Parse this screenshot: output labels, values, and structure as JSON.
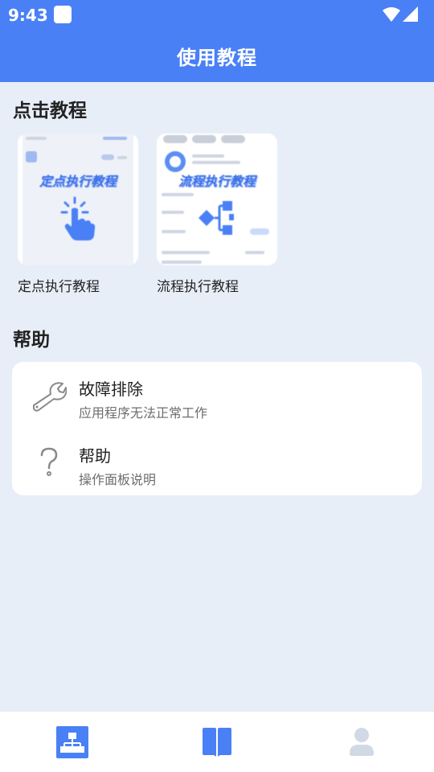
{
  "status_bar": {
    "time": "9:43",
    "icons": [
      "notification-square-icon",
      "wifi-icon",
      "signal-icon"
    ]
  },
  "app_bar": {
    "title": "使用教程"
  },
  "tutorials": {
    "section_title": "点击教程",
    "cards": [
      {
        "thumb_title": "定点执行教程",
        "label": "定点执行教程",
        "icon": "tap-gesture-icon"
      },
      {
        "thumb_title": "流程执行教程",
        "label": "流程执行教程",
        "icon": "flow-diagram-icon"
      }
    ]
  },
  "help": {
    "section_title": "帮助",
    "items": [
      {
        "title": "故障排除",
        "subtitle": "应用程序无法正常工作",
        "icon": "wrench-icon"
      },
      {
        "title": "帮助",
        "subtitle": "操作面板说明",
        "icon": "question-mark-icon"
      }
    ]
  },
  "bottom_nav": {
    "items": [
      {
        "icon": "sitemap-icon",
        "selected": true
      },
      {
        "icon": "book-icon",
        "selected": false
      },
      {
        "icon": "person-icon",
        "selected": false
      }
    ]
  },
  "colors": {
    "primary": "#4a80f5",
    "background": "#e8eef8",
    "inactive_icon": "#d2d9e6"
  }
}
